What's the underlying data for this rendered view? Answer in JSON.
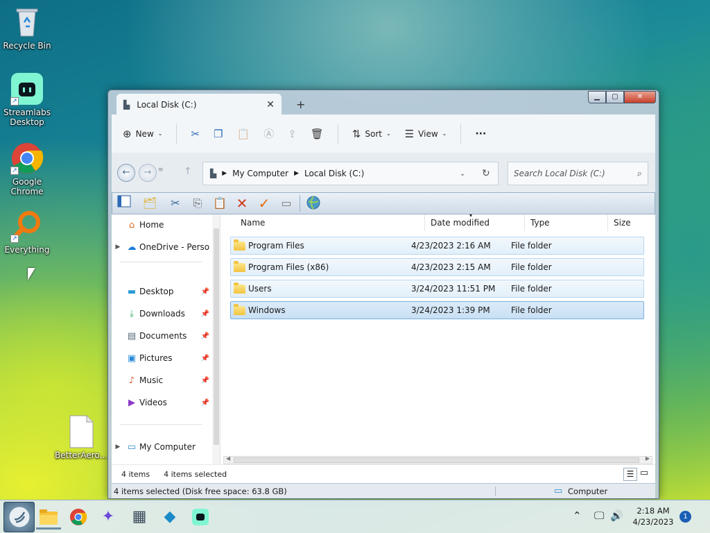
{
  "desktop": {
    "icons": [
      {
        "label": "Recycle Bin",
        "icon": "recycle-bin-icon"
      },
      {
        "label": "Streamlabs Desktop",
        "icon": "streamlabs-icon"
      },
      {
        "label": "Google Chrome",
        "icon": "chrome-icon"
      },
      {
        "label": "Everything",
        "icon": "everything-search-icon"
      },
      {
        "label": "BetterAero...",
        "icon": "file-icon"
      }
    ]
  },
  "window": {
    "tab_title": "Local Disk (C:)",
    "new_tab": "+",
    "commands": {
      "new_label": "New",
      "sort_label": "Sort",
      "view_label": "View",
      "more_label": "···"
    },
    "address": {
      "segments": [
        "My Computer",
        "Local Disk (C:)"
      ]
    },
    "search": {
      "placeholder": "Search Local Disk (C:)"
    },
    "nav": {
      "home": "Home",
      "onedrive": "OneDrive - Perso",
      "desktop": "Desktop",
      "downloads": "Downloads",
      "documents": "Documents",
      "pictures": "Pictures",
      "music": "Music",
      "videos": "Videos",
      "my_computer": "My Computer"
    },
    "columns": {
      "name": "Name",
      "date": "Date modified",
      "type": "Type",
      "size": "Size"
    },
    "files": [
      {
        "name": "Program Files",
        "date": "4/23/2023 2:16 AM",
        "type": "File folder"
      },
      {
        "name": "Program Files (x86)",
        "date": "4/23/2023 2:15 AM",
        "type": "File folder"
      },
      {
        "name": "Users",
        "date": "3/24/2023 11:51 PM",
        "type": "File folder"
      },
      {
        "name": "Windows",
        "date": "3/24/2023 1:39 PM",
        "type": "File folder"
      }
    ],
    "status": {
      "item_count": "4 items",
      "selected": "4 items selected",
      "detail": "4 items selected (Disk free space: 63.8 GB)",
      "location": "Computer"
    }
  },
  "taskbar": {
    "clock_time": "2:18 AM",
    "clock_date": "4/23/2023",
    "notification_count": "1"
  }
}
